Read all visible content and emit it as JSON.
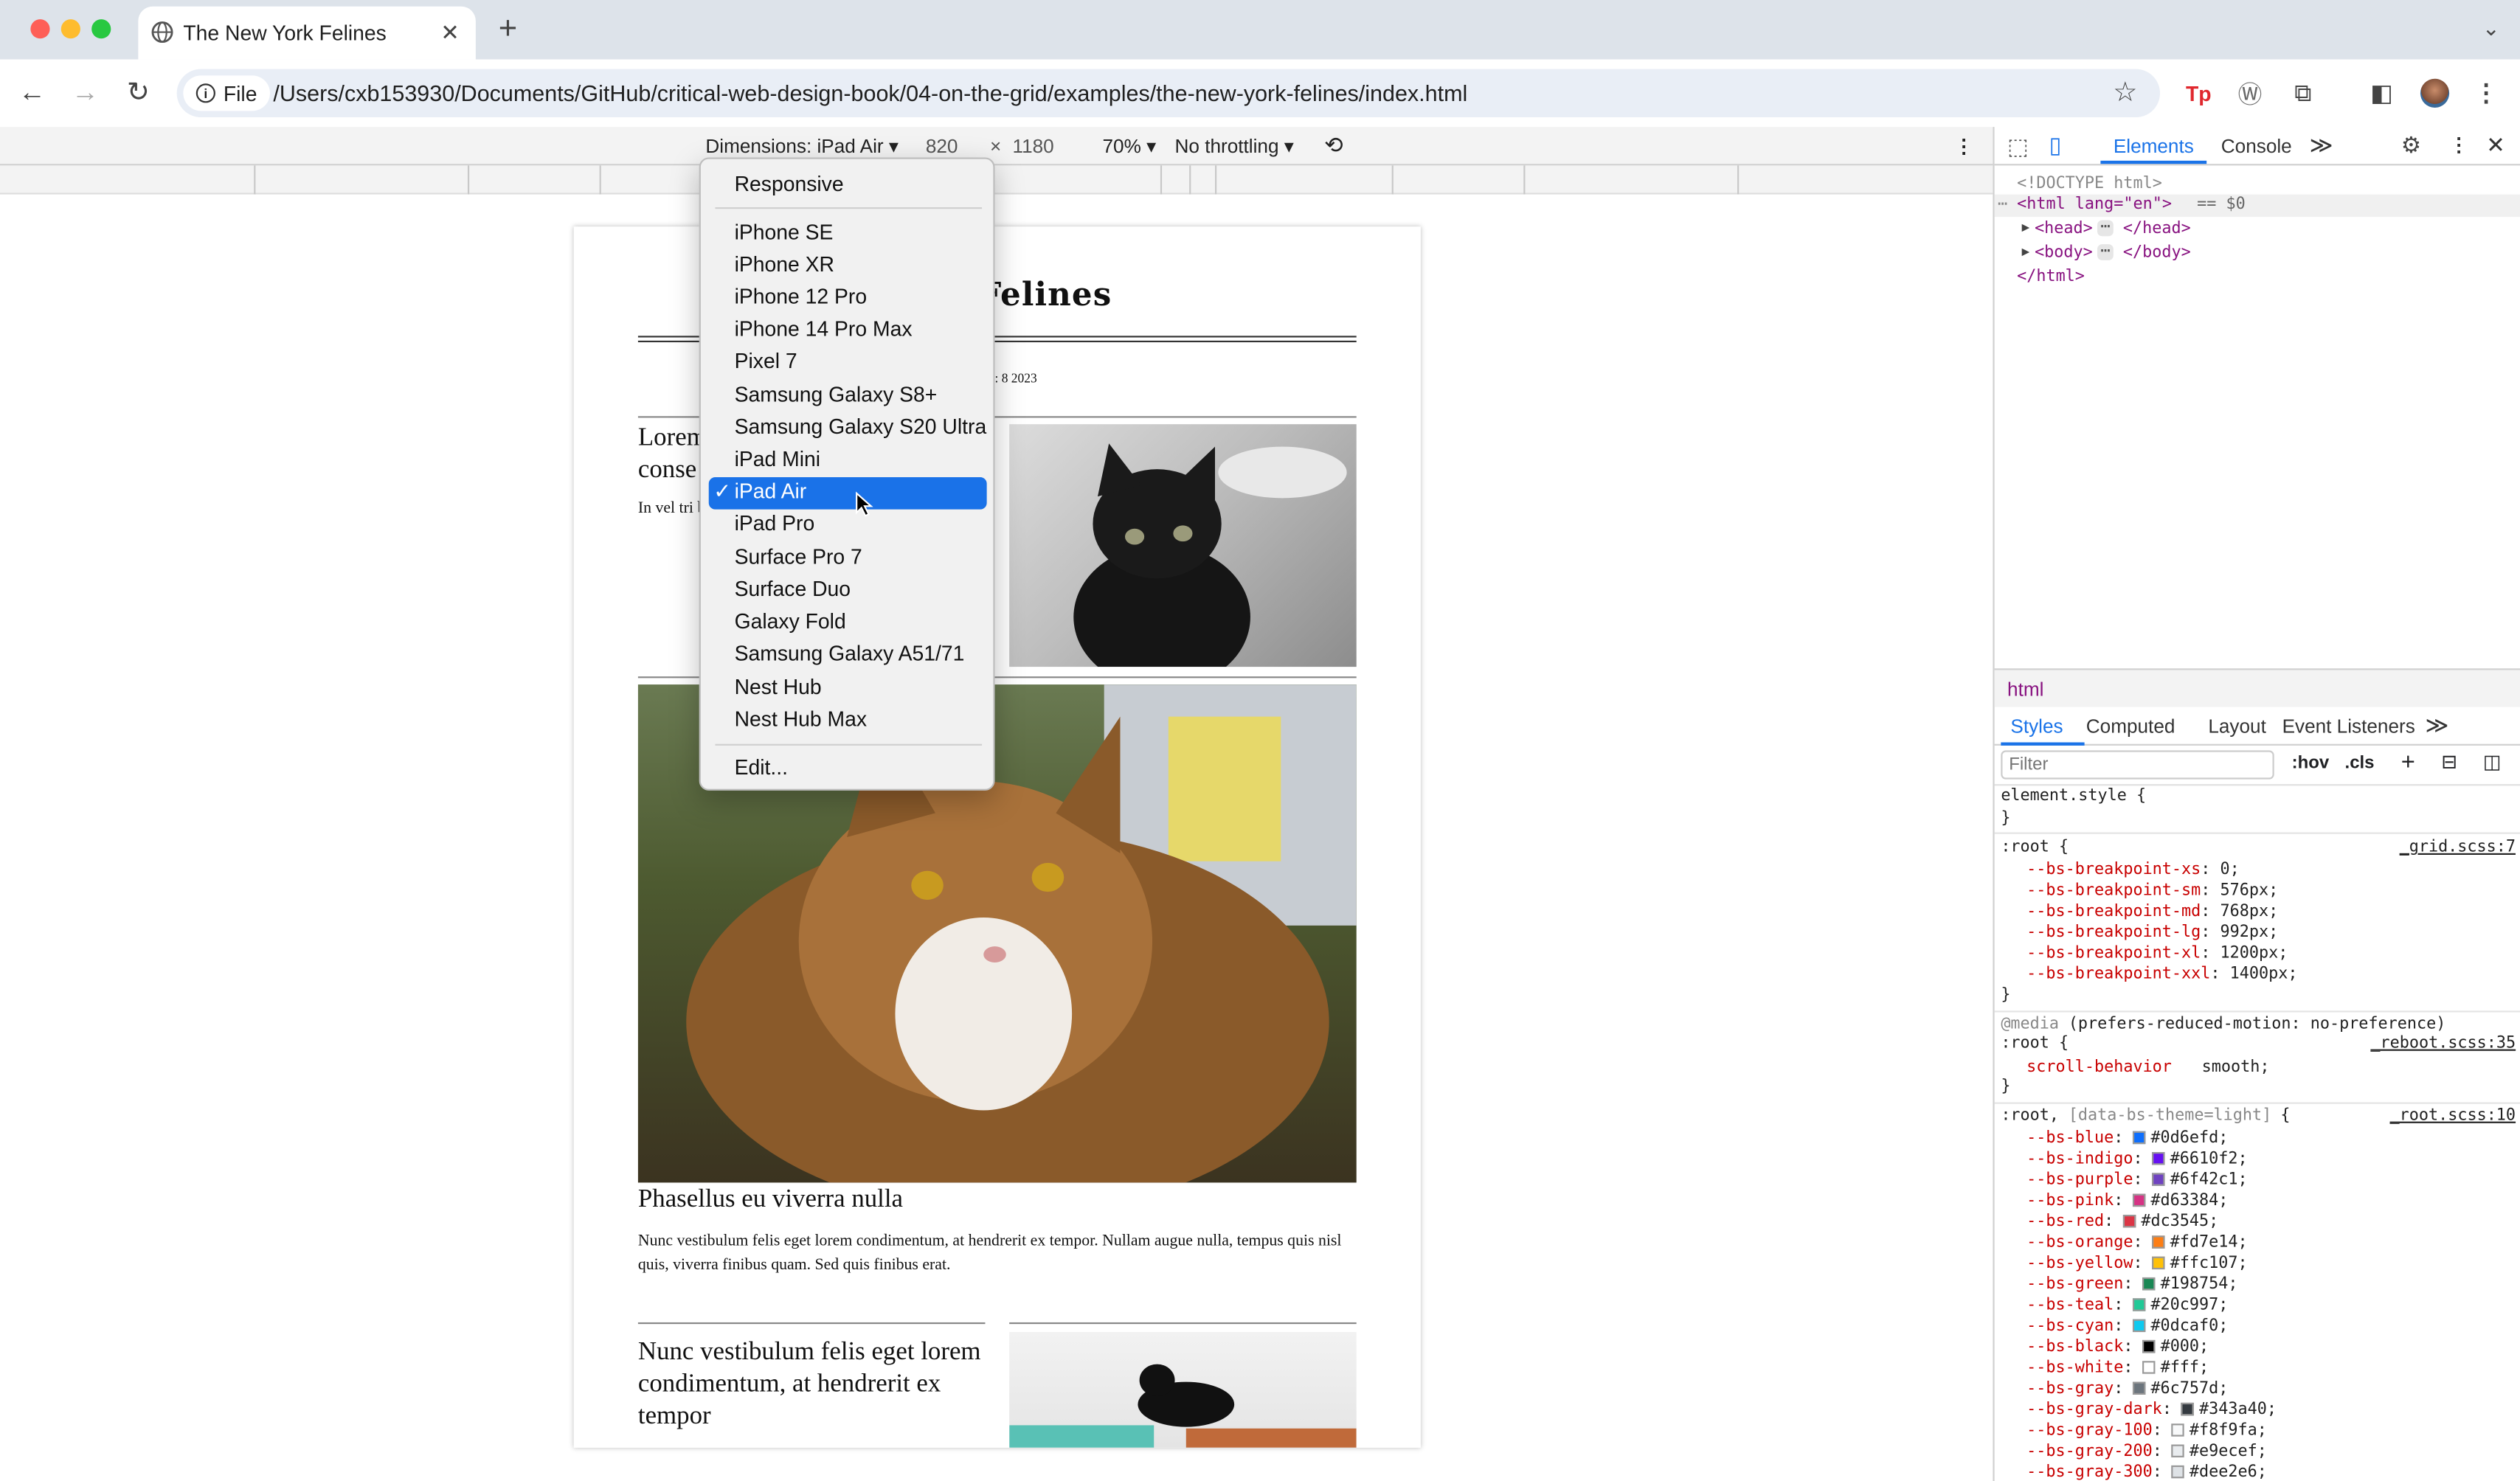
{
  "browser": {
    "tab_title": "The New York Felines",
    "url_chip": "File",
    "url": "/Users/cxb153930/Documents/GitHub/critical-web-design-book/04-on-the-grid/examples/the-new-york-felines/index.html",
    "new_tab": "+",
    "close_tab": "✕"
  },
  "device_toolbar": {
    "dimensions_label": "Dimensions: iPad Air ▾",
    "width": "820",
    "times": "×",
    "height": "1180",
    "zoom": "70% ▾",
    "throttle": "No throttling ▾"
  },
  "device_menu": {
    "responsive": "Responsive",
    "devices": [
      "iPhone SE",
      "iPhone XR",
      "iPhone 12 Pro",
      "iPhone 14 Pro Max",
      "Pixel 7",
      "Samsung Galaxy S8+",
      "Samsung Galaxy S20 Ultra",
      "iPad Mini",
      "iPad Air",
      "iPad Pro",
      "Surface Pro 7",
      "Surface Duo",
      "Galaxy Fold",
      "Samsung Galaxy A51/71",
      "Nest Hub",
      "Nest Hub Max"
    ],
    "selected": "iPad Air",
    "check": "✓",
    "edit": "Edit..."
  },
  "page": {
    "masthead": "York Felines",
    "dateline": ": 8 2023",
    "article1_head": "Lorem ipsum dolor sit amet, conse",
    "article1_body": "In vel tri blandit ia erat, vita ex eget, r",
    "article2_head": "Phasellus eu viverra nulla",
    "article2_body": "Nunc vestibulum felis eget lorem condimentum, at hendrerit ex tempor. Nullam augue nulla, tempus quis nisl quis, viverra finibus quam. Sed quis finibus erat.",
    "article3_head": "Nunc vestibulum felis eget lorem condimentum, at hendrerit ex tempor"
  },
  "devtools": {
    "tabs": [
      "Elements",
      "Console"
    ],
    "more": "≫",
    "dom": {
      "doctype": "<!DOCTYPE html>",
      "html_open": "<html lang=\"en\">",
      "eq": "== $0",
      "head": "<head>",
      "head_close": "</head>",
      "body": "<body>",
      "body_close": "</body>",
      "html_close": "</html>",
      "ellipsis": "⋯"
    },
    "breadcrumb": "html",
    "style_tabs": [
      "Styles",
      "Computed",
      "Layout",
      "Event Listeners"
    ],
    "filter_placeholder": "Filter",
    "hov": ":hov",
    "cls": ".cls",
    "element_style": "element.style {",
    "close_brace": "}",
    "grid_selector": ":root {",
    "grid_src": "_grid.scss:7",
    "grid_props": [
      {
        "name": "--bs-breakpoint-xs",
        "value": "0;"
      },
      {
        "name": "--bs-breakpoint-sm",
        "value": "576px;"
      },
      {
        "name": "--bs-breakpoint-md",
        "value": "768px;"
      },
      {
        "name": "--bs-breakpoint-lg",
        "value": "992px;"
      },
      {
        "name": "--bs-breakpoint-xl",
        "value": "1200px;"
      },
      {
        "name": "--bs-breakpoint-xxl",
        "value": "1400px;"
      }
    ],
    "media": "@media",
    "media_query": "(prefers-reduced-motion: no-preference)",
    "reboot_selector": ":root {",
    "reboot_src": "_reboot.scss:35",
    "reboot_prop": {
      "name": "scroll-behavior",
      "value": "smooth;"
    },
    "root_selector": ":root,",
    "root_selector_extra": "[data-bs-theme=light]",
    "root_brace": "{",
    "root_src": "_root.scss:10",
    "root_props": [
      {
        "name": "--bs-blue",
        "value": "#0d6efd;",
        "color": "#0d6efd"
      },
      {
        "name": "--bs-indigo",
        "value": "#6610f2;",
        "color": "#6610f2"
      },
      {
        "name": "--bs-purple",
        "value": "#6f42c1;",
        "color": "#6f42c1"
      },
      {
        "name": "--bs-pink",
        "value": "#d63384;",
        "color": "#d63384"
      },
      {
        "name": "--bs-red",
        "value": "#dc3545;",
        "color": "#dc3545"
      },
      {
        "name": "--bs-orange",
        "value": "#fd7e14;",
        "color": "#fd7e14"
      },
      {
        "name": "--bs-yellow",
        "value": "#ffc107;",
        "color": "#ffc107"
      },
      {
        "name": "--bs-green",
        "value": "#198754;",
        "color": "#198754"
      },
      {
        "name": "--bs-teal",
        "value": "#20c997;",
        "color": "#20c997"
      },
      {
        "name": "--bs-cyan",
        "value": "#0dcaf0;",
        "color": "#0dcaf0"
      },
      {
        "name": "--bs-black",
        "value": "#000;",
        "color": "#000000"
      },
      {
        "name": "--bs-white",
        "value": "#fff;",
        "color": "#ffffff"
      },
      {
        "name": "--bs-gray",
        "value": "#6c757d;",
        "color": "#6c757d"
      },
      {
        "name": "--bs-gray-dark",
        "value": "#343a40;",
        "color": "#343a40"
      },
      {
        "name": "--bs-gray-100",
        "value": "#f8f9fa;",
        "color": "#f8f9fa"
      },
      {
        "name": "--bs-gray-200",
        "value": "#e9ecef;",
        "color": "#e9ecef"
      },
      {
        "name": "--bs-gray-300",
        "value": "#dee2e6;",
        "color": "#dee2e6"
      }
    ]
  }
}
